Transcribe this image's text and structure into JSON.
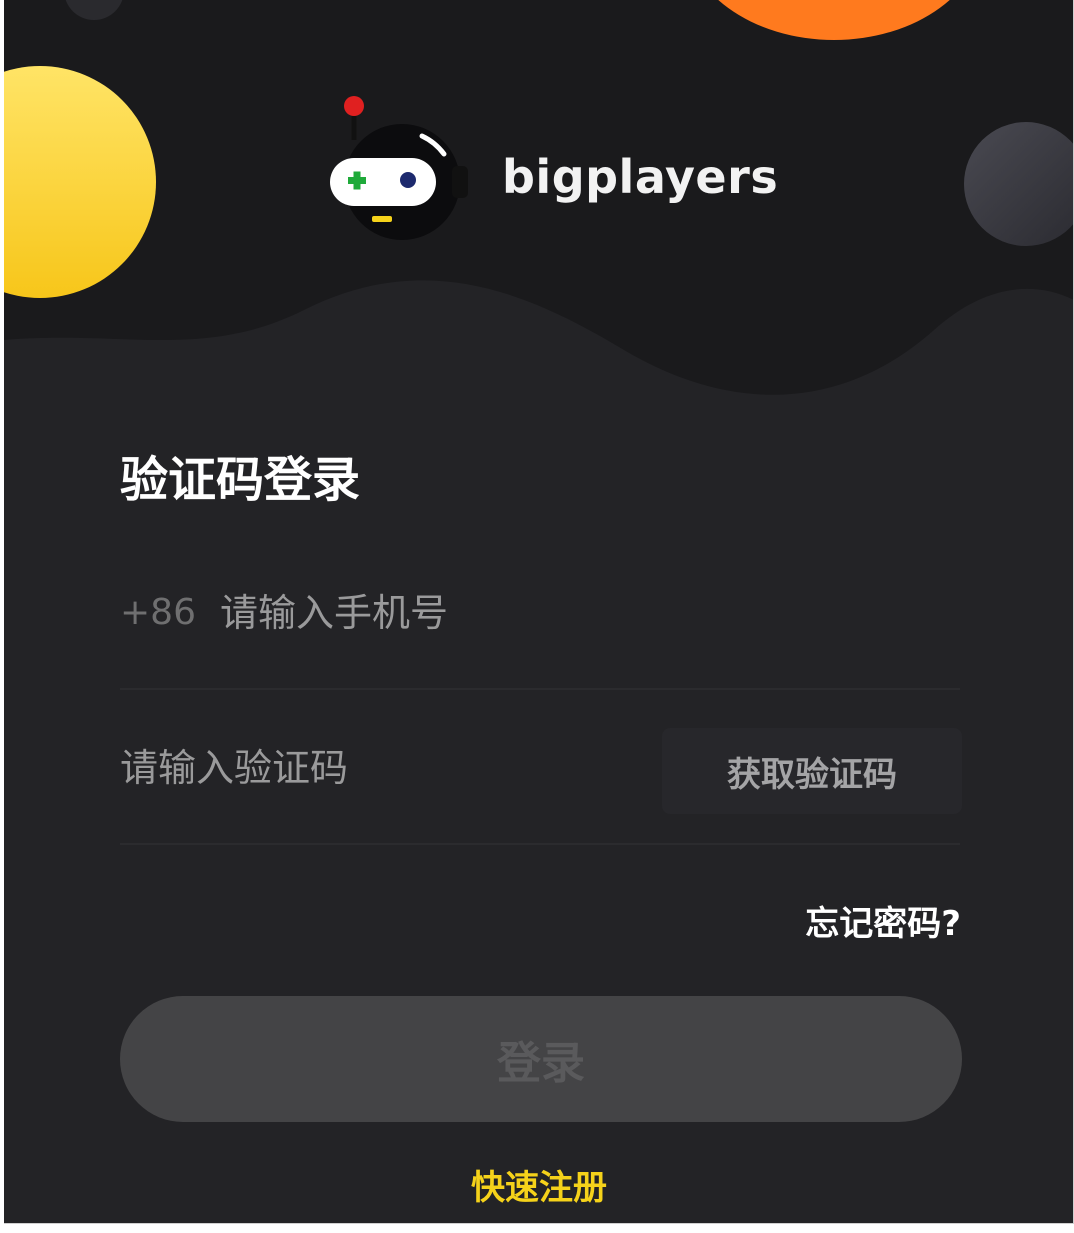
{
  "brand": {
    "name": "bigplayers"
  },
  "login": {
    "title": "验证码登录",
    "country_code": "+86",
    "phone_placeholder": "请输入手机号",
    "code_placeholder": "请输入验证码",
    "get_code_label": "获取验证码",
    "forgot_label": "忘记密码?",
    "submit_label": "登录",
    "register_label": "快速注册"
  },
  "colors": {
    "background": "#1a1a1c",
    "wave": "#232326",
    "accent_yellow": "#f5d21a",
    "accent_orange": "#ff7a1e",
    "button_disabled": "#444446"
  }
}
